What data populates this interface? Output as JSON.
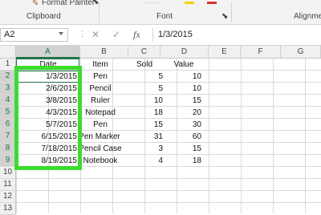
{
  "ribbon": {
    "format_painter": "Format Painter",
    "clipboard": "Clipboard",
    "font": "Font",
    "alignment": "Alignmen"
  },
  "formula_bar": {
    "name_box": "A2",
    "cancel_icon": "x-icon",
    "enter_icon": "check-icon",
    "fx_label": "fx",
    "formula_value": "1/3/2015"
  },
  "columns": [
    "A",
    "B",
    "C",
    "D",
    "E",
    "F",
    "G"
  ],
  "rows": [
    "1",
    "2",
    "3",
    "4",
    "5",
    "6",
    "7",
    "8",
    "9",
    "10",
    "11",
    "12",
    "13"
  ],
  "table": {
    "headers": [
      "Date",
      "Item",
      "Sold",
      "Value"
    ],
    "data": [
      [
        "1/3/2015",
        "Pen",
        "5",
        "10"
      ],
      [
        "2/6/2015",
        "Pencil",
        "5",
        "10"
      ],
      [
        "3/8/2015",
        "Ruler",
        "10",
        "15"
      ],
      [
        "4/3/2015",
        "Notepad",
        "18",
        "20"
      ],
      [
        "5/7/2015",
        "Pen",
        "15",
        "30"
      ],
      [
        "6/15/2015",
        "Pen Marker",
        "31",
        "60"
      ],
      [
        "7/18/2015",
        "Pencil Case",
        "3",
        "15"
      ],
      [
        "8/19/2015",
        "Notebook",
        "4",
        "18"
      ]
    ]
  },
  "colors": {
    "highlight": "#3cdc2c",
    "selection": "#217346",
    "font_color_swatch": "#e03030",
    "fill_color_swatch": "#f2d300"
  }
}
